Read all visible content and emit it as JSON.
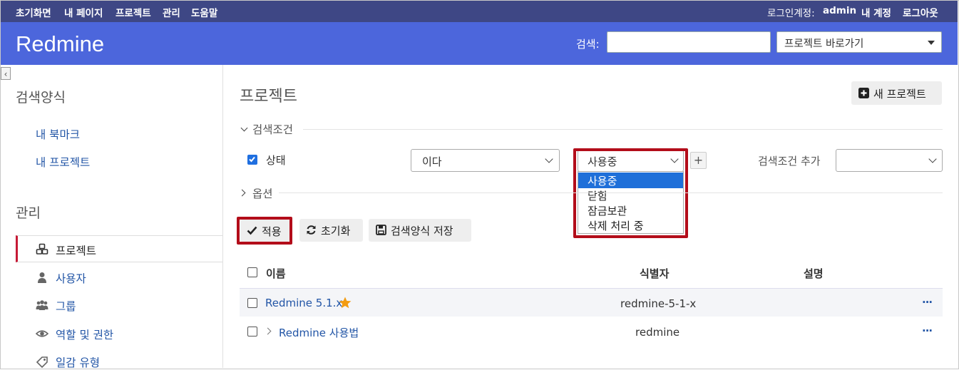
{
  "top_menu": {
    "items": [
      "초기화면",
      "내 페이지",
      "프로젝트",
      "관리",
      "도움말"
    ],
    "login_label": "로그인계정:",
    "login_user": "admin",
    "my_account": "내 계정",
    "logout": "로그아웃"
  },
  "header": {
    "app_title": "Redmine",
    "search_label": "검색:",
    "search_value": "",
    "jump_label": "프로젝트 바로가기"
  },
  "sidebar": {
    "queries_heading": "검색양식",
    "query_links": [
      "내 북마크",
      "내 프로젝트"
    ],
    "admin_heading": "관리",
    "admin_items": [
      {
        "label": "프로젝트",
        "icon": "projects-icon"
      },
      {
        "label": "사용자",
        "icon": "user-icon"
      },
      {
        "label": "그룹",
        "icon": "group-icon"
      },
      {
        "label": "역할 및 권한",
        "icon": "eye-icon"
      },
      {
        "label": "일감 유형",
        "icon": "tracker-icon"
      }
    ]
  },
  "content": {
    "title": "프로젝트",
    "new_project": "새 프로젝트",
    "filters_legend": "검색조건",
    "filter": {
      "field": "상태",
      "checked": true,
      "operator": "이다",
      "value": "사용중",
      "options": [
        "사용중",
        "닫힘",
        "잠금보관",
        "삭제 처리 중"
      ]
    },
    "add_filter_label": "검색조건 추가",
    "options_legend": "옵션",
    "buttons": {
      "apply": "적용",
      "clear": "초기화",
      "save": "검색양식 저장"
    },
    "columns": [
      "이름",
      "식별자",
      "설명"
    ],
    "rows": [
      {
        "name": "Redmine 5.1.x",
        "identifier": "redmine-5-1-x",
        "starred": true,
        "expandable": false,
        "actions": "···"
      },
      {
        "name": "Redmine 사용법",
        "identifier": "redmine",
        "starred": false,
        "expandable": true,
        "actions": "···"
      }
    ]
  },
  "colors": {
    "top_bar": "#3e4785",
    "header": "#4c66dc",
    "link": "#2255a6",
    "highlight": "#b30d1a",
    "selected_option": "#1e6fd9"
  }
}
